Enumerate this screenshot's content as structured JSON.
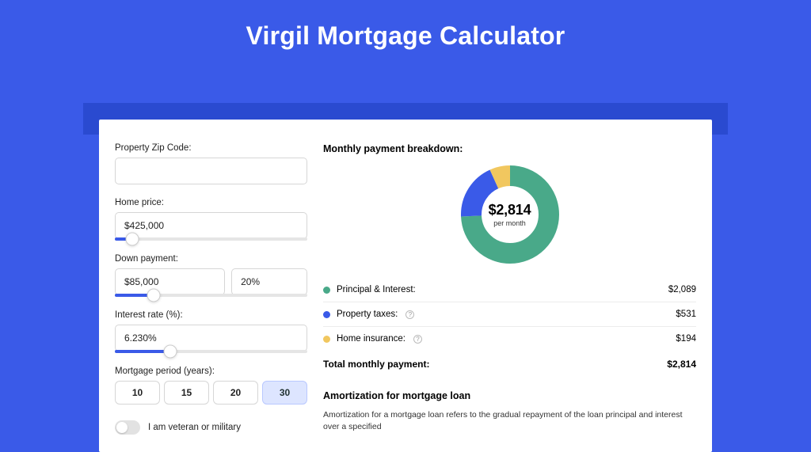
{
  "title": "Virgil Mortgage Calculator",
  "form": {
    "zip_label": "Property Zip Code:",
    "zip_value": "",
    "home_price_label": "Home price:",
    "home_price_value": "$425,000",
    "home_price_slider_pct": 9,
    "down_payment_label": "Down payment:",
    "down_payment_value": "$85,000",
    "down_payment_pct_value": "20%",
    "down_payment_slider_pct": 20,
    "interest_label": "Interest rate (%):",
    "interest_value": "6.230%",
    "interest_slider_pct": 29,
    "period_label": "Mortgage period (years):",
    "period_options": [
      "10",
      "15",
      "20",
      "30"
    ],
    "period_selected": "30",
    "veteran_label": "I am veteran or military"
  },
  "breakdown": {
    "title": "Monthly payment breakdown:",
    "total_amount": "$2,814",
    "per_month_label": "per month",
    "items": [
      {
        "label": "Principal & Interest:",
        "value": "$2,089",
        "color": "#49a989",
        "has_info": false
      },
      {
        "label": "Property taxes:",
        "value": "$531",
        "color": "#3a5ae8",
        "has_info": true
      },
      {
        "label": "Home insurance:",
        "value": "$194",
        "color": "#f1c75f",
        "has_info": true
      }
    ],
    "total_label": "Total monthly payment:",
    "total_value": "$2,814"
  },
  "chart_data": {
    "type": "pie",
    "title": "Monthly payment breakdown",
    "series": [
      {
        "name": "Principal & Interest",
        "value": 2089,
        "color": "#49a989"
      },
      {
        "name": "Property taxes",
        "value": 531,
        "color": "#3a5ae8"
      },
      {
        "name": "Home insurance",
        "value": 194,
        "color": "#f1c75f"
      }
    ],
    "total": 2814
  },
  "amortization": {
    "title": "Amortization for mortgage loan",
    "text": "Amortization for a mortgage loan refers to the gradual repayment of the loan principal and interest over a specified"
  }
}
